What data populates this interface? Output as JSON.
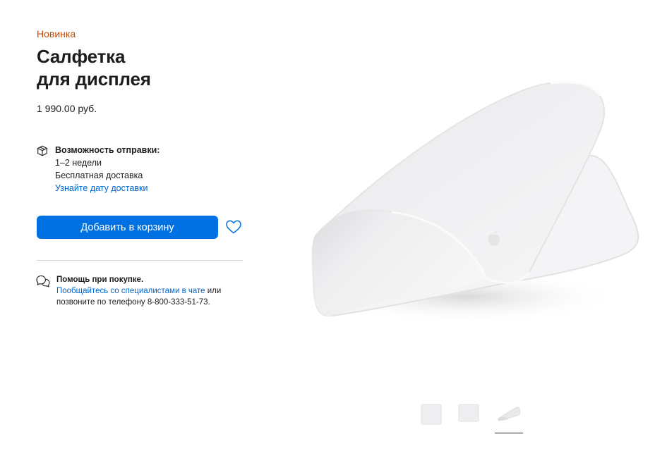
{
  "product": {
    "badge": "Новинка",
    "title_line1": "Салфетка",
    "title_line2": "для дисплея",
    "price": "1 990.00 руб."
  },
  "shipping": {
    "icon": "box-icon",
    "heading": "Возможность отправки:",
    "time": "1–2 недели",
    "delivery": "Бесплатная доставка",
    "link": "Узнайте дату доставки"
  },
  "actions": {
    "add_to_bag": "Добавить в корзину",
    "favorite_icon": "heart-icon"
  },
  "help": {
    "icon": "chat-bubbles-icon",
    "heading": "Помощь при покупке.",
    "chat_link": "Пообщайтесь со специалистами в чате",
    "text_after_link": " или",
    "phone_line": "позвоните по телефону 8-800-333-51-73."
  },
  "gallery": {
    "thumbnails": [
      "thumbnail-flat",
      "thumbnail-flat-angle",
      "thumbnail-folded"
    ],
    "selected_index": 2
  },
  "colors": {
    "badge": "#bf4800",
    "button": "#0071e3",
    "link": "#0066cc",
    "text": "#1d1d1f"
  }
}
